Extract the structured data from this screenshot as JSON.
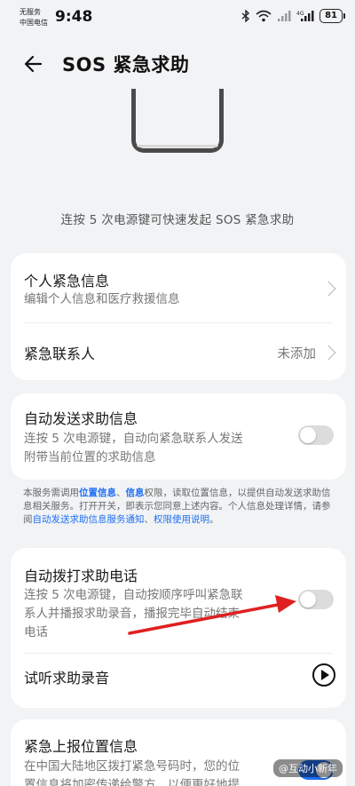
{
  "status_bar": {
    "carrier_line1": "无服务",
    "carrier_line2": "中国电信",
    "time": "9:48",
    "battery": "81"
  },
  "header": {
    "title": "SOS 紧急求助"
  },
  "intro_text": "连按 5 次电源键可快速发起 SOS 紧急求助",
  "card1": {
    "row1_title": "个人紧急信息",
    "row1_sub": "编辑个人信息和医疗救援信息",
    "row2_title": "紧急联系人",
    "row2_value": "未添加"
  },
  "card2": {
    "title": "自动发送求助信息",
    "sub_line1": "连按 5 次电源键，自动向紧急联系人发送",
    "sub_line2": "附带当前位置的求助信息",
    "toggle_on": false
  },
  "notice": {
    "part1": "本服务需调用",
    "hl1": "位置信息",
    "sep1": "、",
    "hl2": "信息",
    "part2": "权限，读取位置信息，以提供自动发送求助信息相关服务。打开开关，即表示您同意上述内容。个人信息处理详情，请参阅",
    "link1": "自动发送求助信息服务通知",
    "sep2": "、",
    "link2": "权限使用说明",
    "end": "。"
  },
  "card3": {
    "title": "自动拨打求助电话",
    "sub_line1": "连按 5 次电源键，自动按顺序呼叫紧急联",
    "sub_line2": "系人并播报求助录音，播报完毕自动结束",
    "sub_line3": "电话",
    "toggle_on": false,
    "row2_title": "试听求助录音"
  },
  "card4": {
    "title": "紧急上报位置信息",
    "sub_line1": "在中国大陆地区拨打紧急号码时，您的位",
    "sub_line2": "置信息将加密传递给警方，以便更好地提",
    "toggle_on": true
  },
  "watermark": "@互动小新年",
  "colors": {
    "accent": "#1f6ff5",
    "annotation_arrow": "#e02020"
  }
}
